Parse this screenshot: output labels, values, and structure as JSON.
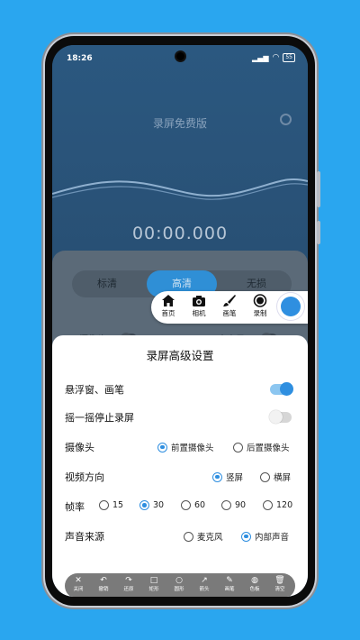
{
  "status_bar": {
    "time": "18:26",
    "signal": "📶",
    "wifi": "◔",
    "battery": "55"
  },
  "app": {
    "title": "录屏免费版",
    "timer": "00:00.000"
  },
  "quality_tabs": [
    {
      "label": "标清",
      "active": false
    },
    {
      "label": "高清",
      "active": true
    },
    {
      "label": "无损",
      "active": false
    }
  ],
  "background_toggles": {
    "camera_label": "摄像头",
    "mic_label": "麦克风"
  },
  "floating_toolbar": {
    "items": [
      {
        "label": "首页",
        "icon": "home-icon"
      },
      {
        "label": "相机",
        "icon": "camera-icon"
      },
      {
        "label": "画笔",
        "icon": "brush-icon"
      },
      {
        "label": "录制",
        "icon": "record-icon"
      }
    ]
  },
  "settings_sheet": {
    "title": "录屏高级设置",
    "float_window": {
      "label": "悬浮窗、画笔",
      "on": true
    },
    "shake_stop": {
      "label": "摇一摇停止录屏",
      "on": false
    },
    "camera": {
      "label": "摄像头",
      "options": [
        "前置摄像头",
        "后置摄像头"
      ],
      "selected": "前置摄像头"
    },
    "orientation": {
      "label": "视频方向",
      "options": [
        "竖屏",
        "横屏"
      ],
      "selected": "竖屏"
    },
    "framerate": {
      "label": "帧率",
      "options": [
        "15",
        "30",
        "60",
        "90",
        "120"
      ],
      "selected": "30"
    },
    "audio_source": {
      "label": "声音来源",
      "options": [
        "麦克风",
        "内部声音"
      ],
      "selected": "内部声音"
    }
  },
  "draw_toolbar": {
    "items": [
      {
        "label": "关闭",
        "glyph": "✕"
      },
      {
        "label": "撤销",
        "glyph": "↶"
      },
      {
        "label": "还原",
        "glyph": "↷"
      },
      {
        "label": "矩形",
        "glyph": "□"
      },
      {
        "label": "圆形",
        "glyph": "○"
      },
      {
        "label": "箭头",
        "glyph": "↗"
      },
      {
        "label": "画笔",
        "glyph": "✎"
      },
      {
        "label": "色板",
        "glyph": "◍"
      },
      {
        "label": "清空",
        "glyph": "🗑"
      }
    ]
  },
  "colors": {
    "accent": "#2f8fe0",
    "background": "#2aa6ef",
    "header": "#2b5880"
  }
}
